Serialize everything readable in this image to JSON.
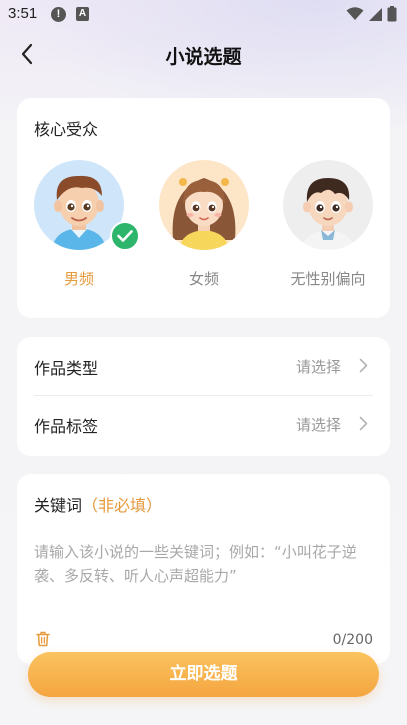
{
  "status_bar": {
    "time": "3:51",
    "notification_badge": "!",
    "a_badge": "A"
  },
  "header": {
    "title": "小说选题"
  },
  "audience": {
    "title": "核心受众",
    "options": [
      {
        "label": "男频",
        "selected": true
      },
      {
        "label": "女频",
        "selected": false
      },
      {
        "label": "无性别偏向",
        "selected": false
      }
    ]
  },
  "work_type": {
    "label": "作品类型",
    "value": "请选择"
  },
  "work_tags": {
    "label": "作品标签",
    "value": "请选择"
  },
  "keywords": {
    "title": "关键词",
    "optional": "（非必填）",
    "placeholder": "请输入该小说的一些关键词；例如：“小叫花子逆袭、多反转、听人心声超能力”",
    "value": "",
    "count": "0/200"
  },
  "submit": {
    "label": "立即选题"
  },
  "colors": {
    "accent": "#e69a3c",
    "check": "#2db56b",
    "button_top": "#fbc35f",
    "button_bottom": "#f4a540"
  }
}
